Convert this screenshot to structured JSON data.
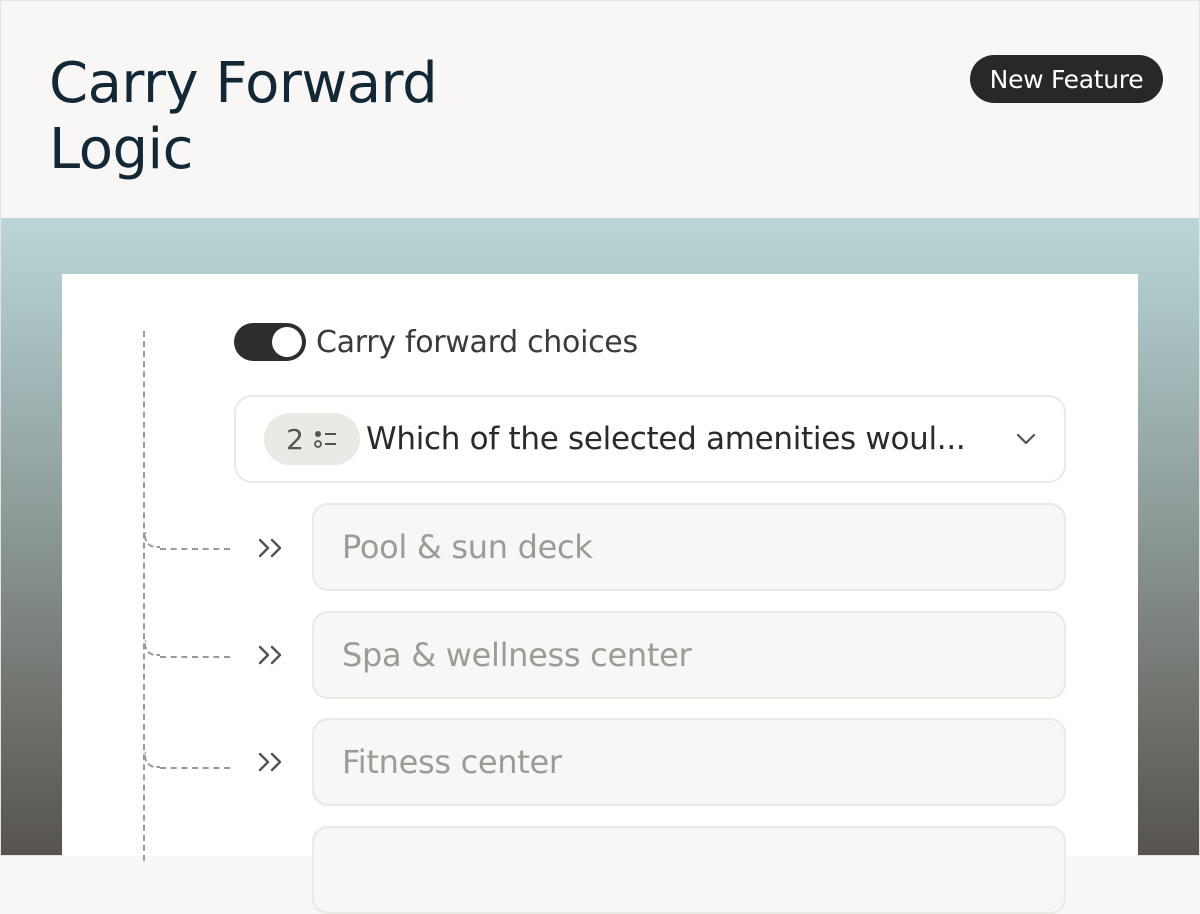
{
  "header": {
    "title_line1": "Carry Forward",
    "title_line2": "Logic",
    "badge": "New Feature"
  },
  "carry_forward": {
    "toggle_on": true,
    "label": "Carry forward choices"
  },
  "question_select": {
    "number": "2",
    "type_icon": "multiple-choice-icon",
    "text": "Which of the selected amenities woul...",
    "caret_icon": "chevron-down-icon"
  },
  "choices": [
    {
      "label": "Pool & sun deck"
    },
    {
      "label": "Spa & wellness center"
    },
    {
      "label": "Fitness center"
    },
    {
      "label": ""
    }
  ],
  "colors": {
    "title": "#122836",
    "badge_bg": "#2a2826",
    "toggle_on": "#2f2e2c",
    "option_text": "#9e9b97",
    "gradient_top": "#bcd6d8",
    "gradient_bottom": "#575350"
  }
}
